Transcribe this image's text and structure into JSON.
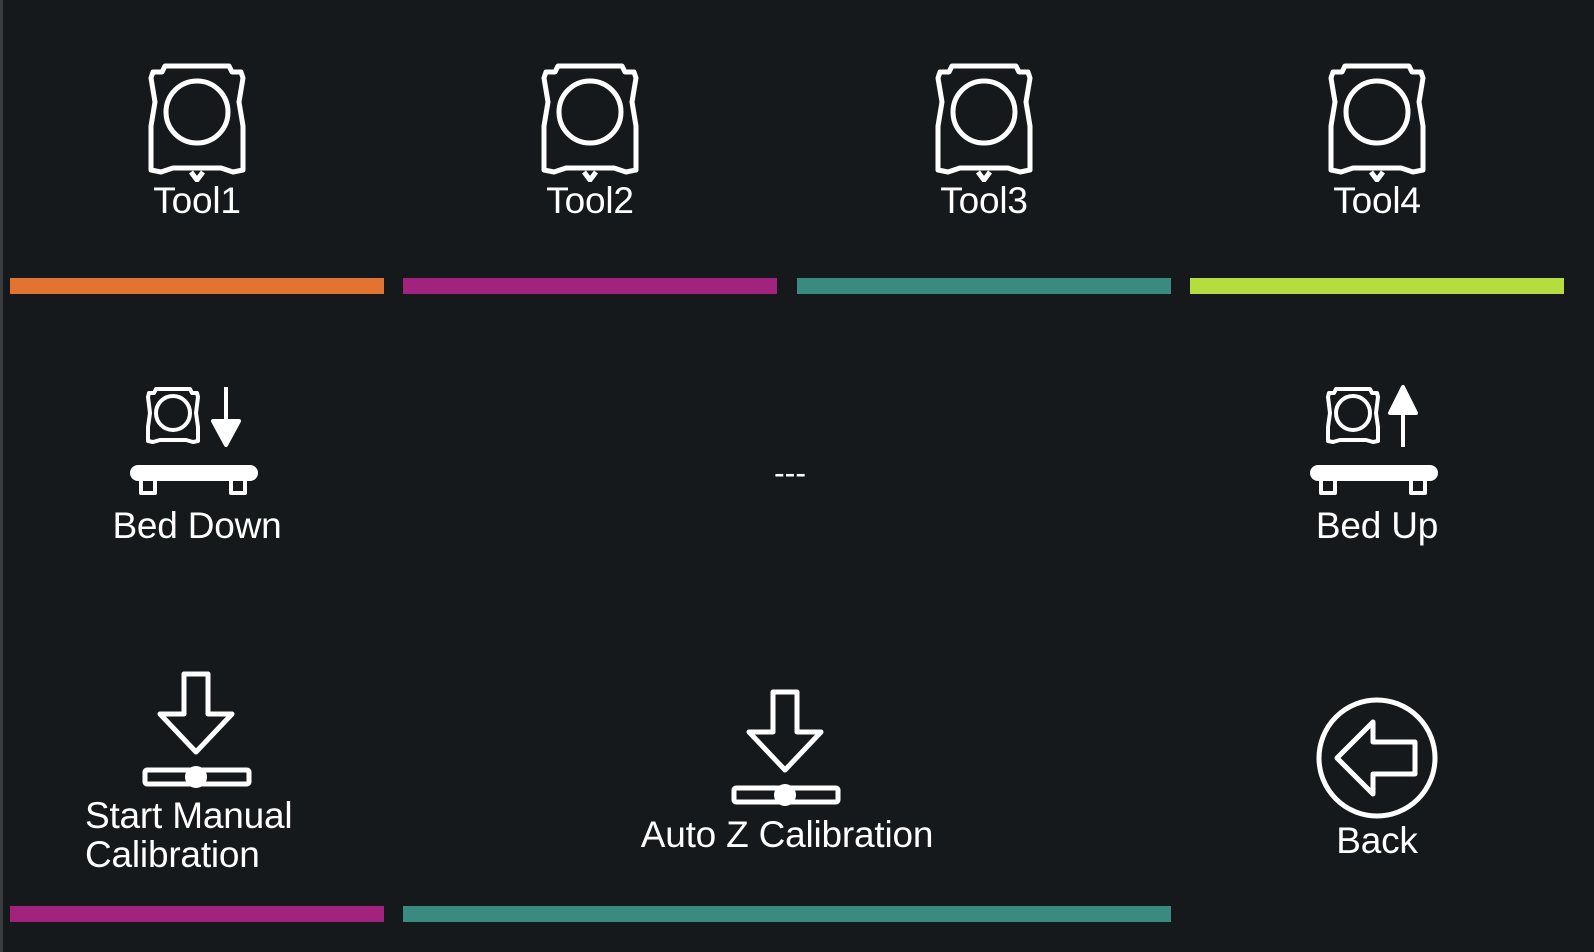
{
  "tools": [
    {
      "label": "Tool1",
      "color": "#e27330"
    },
    {
      "label": "Tool2",
      "color": "#a1237d"
    },
    {
      "label": "Tool3",
      "color": "#3a8b7f"
    },
    {
      "label": "Tool4",
      "color": "#b5dd3f"
    }
  ],
  "bed_down": {
    "label": "Bed Down",
    "icon": "bed-down-icon"
  },
  "placeholder": {
    "label": "---"
  },
  "bed_up": {
    "label": "Bed Up",
    "icon": "bed-up-icon"
  },
  "manual_calibration": {
    "label_line1": "Start Manual",
    "label_line2": "Calibration",
    "color": "#a1237d"
  },
  "auto_z_calibration": {
    "label": "Auto Z Calibration",
    "color": "#3a8b7f"
  },
  "back": {
    "label": "Back",
    "icon": "back-arrow-icon"
  }
}
